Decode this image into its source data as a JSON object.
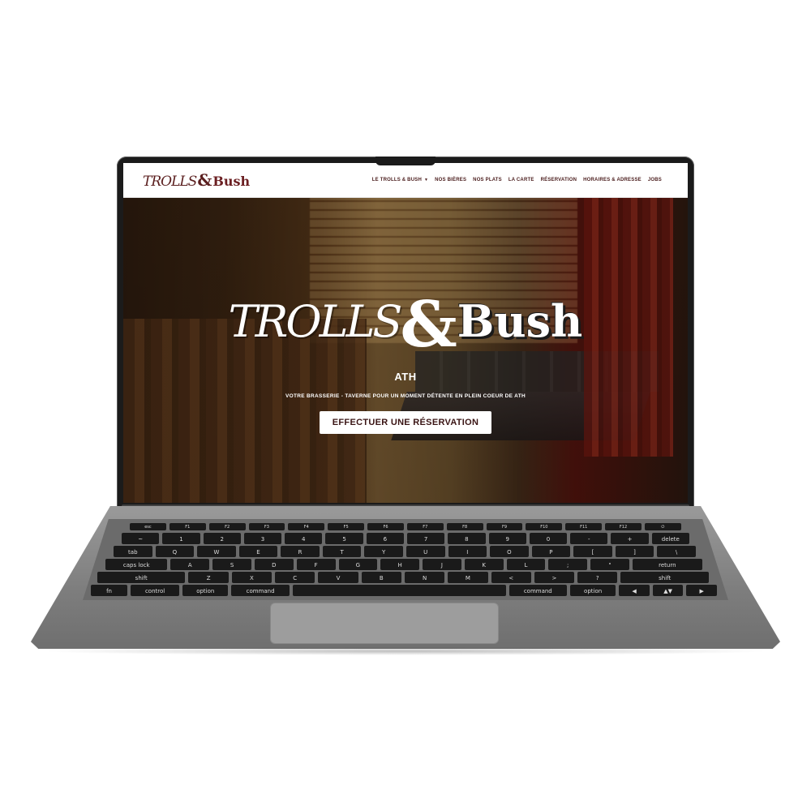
{
  "site": {
    "logo": {
      "part1": "TROLLS",
      "amp": "&",
      "part2": "Bush"
    },
    "nav": [
      {
        "label": "LE TROLLS & BUSH",
        "has_dropdown": true
      },
      {
        "label": "NOS BIÈRES"
      },
      {
        "label": "NOS PLATS"
      },
      {
        "label": "LA CARTE"
      },
      {
        "label": "RÉSERVATION"
      },
      {
        "label": "HORAIRES & ADRESSE"
      },
      {
        "label": "JOBS"
      }
    ],
    "hero": {
      "logo_part1": "TROLLS",
      "logo_amp": "&",
      "logo_part2": "Bush",
      "city": "ATH",
      "tagline": "VOTRE BRASSERIE - TAVERNE POUR UN MOMENT DÉTENTE EN PLEIN COEUR DE ATH",
      "cta": "EFFECTUER UNE RÉSERVATION"
    },
    "colors": {
      "brand": "#5a1e1e",
      "cta_text": "#3a1414",
      "header_bg": "#ffffff"
    }
  },
  "keyboard": {
    "row_fn": [
      "esc",
      "F1",
      "F2",
      "F3",
      "F4",
      "F5",
      "F6",
      "F7",
      "F8",
      "F9",
      "F10",
      "F11",
      "F12",
      "⏻"
    ],
    "row_num": [
      "~",
      "1",
      "2",
      "3",
      "4",
      "5",
      "6",
      "7",
      "8",
      "9",
      "0",
      "-",
      "+",
      "delete"
    ],
    "row_q": [
      "tab",
      "Q",
      "W",
      "E",
      "R",
      "T",
      "Y",
      "U",
      "I",
      "O",
      "P",
      "[",
      "]",
      "\\"
    ],
    "row_a": [
      "caps lock",
      "A",
      "S",
      "D",
      "F",
      "G",
      "H",
      "J",
      "K",
      "L",
      ";",
      "\"",
      "return"
    ],
    "row_z": [
      "shift",
      "Z",
      "X",
      "C",
      "V",
      "B",
      "N",
      "M",
      "<",
      ">",
      "?",
      "shift"
    ],
    "row_mod": [
      "fn",
      "control",
      "option",
      "command",
      "",
      "command",
      "option",
      "◀",
      "▲▼",
      "▶"
    ]
  }
}
